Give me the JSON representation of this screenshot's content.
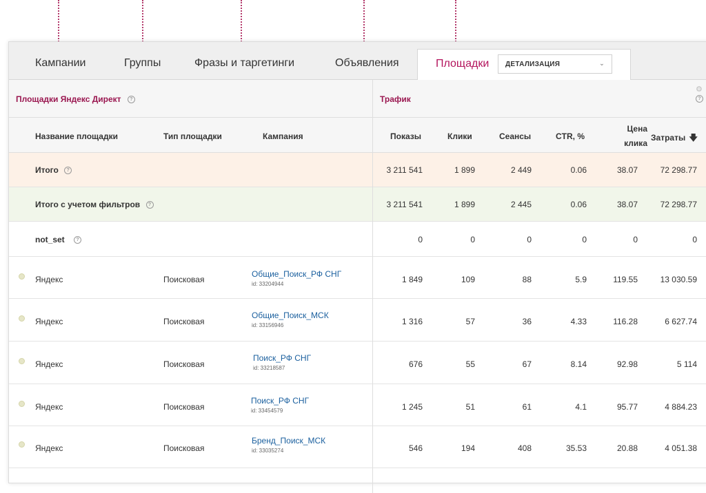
{
  "tabs": [
    {
      "label": "Кампании"
    },
    {
      "label": "Группы"
    },
    {
      "label": "Фразы и таргетинги"
    },
    {
      "label": "Объявления"
    },
    {
      "label": "Площадки"
    }
  ],
  "detail_select": {
    "value": "ДЕТАЛИЗАЦИЯ"
  },
  "groups": {
    "left_title": "Площадки Яндекс Директ",
    "right_title": "Трафик"
  },
  "columns": {
    "name": "Название площадки",
    "type": "Тип площадки",
    "campaign": "Кампания",
    "shows": "Показы",
    "clicks": "Клики",
    "sessions": "Сеансы",
    "ctr": "CTR, %",
    "price_l1": "Цена",
    "price_l2": "клика",
    "cost": "Затраты"
  },
  "colors": {
    "accent": "#b3135c",
    "total_bg": "#fdf1e7",
    "filtered_bg": "#f1f6ea",
    "link": "#1a5f9e"
  },
  "summary": [
    {
      "label": "Итого",
      "shows": "3 211 541",
      "clicks": "1 899",
      "sessions": "2 449",
      "ctr": "0.06",
      "price": "38.07",
      "cost": "72 298.77"
    },
    {
      "label": "Итого с учетом фильтров",
      "shows": "3 211 541",
      "clicks": "1 899",
      "sessions": "2 445",
      "ctr": "0.06",
      "price": "38.07",
      "cost": "72 298.77"
    },
    {
      "label": "not_set",
      "shows": "0",
      "clicks": "0",
      "sessions": "0",
      "ctr": "0",
      "price": "0",
      "cost": "0"
    }
  ],
  "rows": [
    {
      "site": "Яндекс",
      "type": "Поисковая",
      "campaign": "Общие_Поиск_РФ СНГ",
      "id": "id: 33204944",
      "shows": "1 849",
      "clicks": "109",
      "sessions": "88",
      "ctr": "5.9",
      "price": "119.55",
      "cost": "13 030.59"
    },
    {
      "site": "Яндекс",
      "type": "Поисковая",
      "campaign": "Общие_Поиск_МСК",
      "id": "id: 33156946",
      "shows": "1 316",
      "clicks": "57",
      "sessions": "36",
      "ctr": "4.33",
      "price": "116.28",
      "cost": "6 627.74"
    },
    {
      "site": "Яндекс",
      "type": "Поисковая",
      "campaign": "Поиск_РФ СНГ",
      "id": "id: 33218587",
      "shows": "676",
      "clicks": "55",
      "sessions": "67",
      "ctr": "8.14",
      "price": "92.98",
      "cost": "5 114"
    },
    {
      "site": "Яндекс",
      "type": "Поисковая",
      "campaign": "Поиск_РФ СНГ",
      "id": "id: 33454579",
      "shows": "1 245",
      "clicks": "51",
      "sessions": "61",
      "ctr": "4.1",
      "price": "95.77",
      "cost": "4 884.23"
    },
    {
      "site": "Яндекс",
      "type": "Поисковая",
      "campaign": "Бренд_Поиск_МСК",
      "id": "id: 33035274",
      "shows": "546",
      "clicks": "194",
      "sessions": "408",
      "ctr": "35.53",
      "price": "20.88",
      "cost": "4 051.38"
    }
  ]
}
